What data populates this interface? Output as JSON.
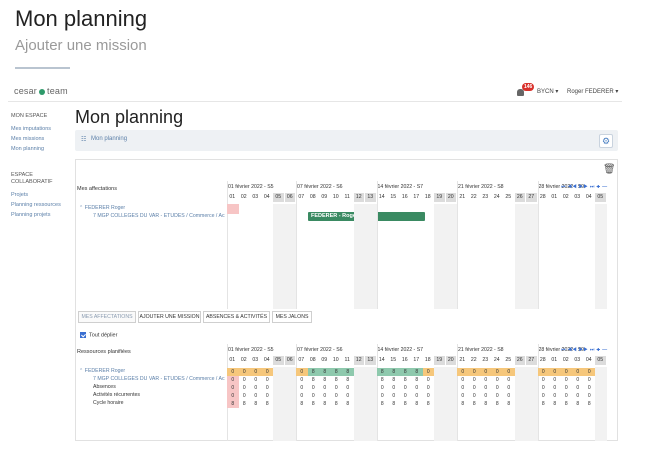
{
  "hero": {
    "title": "Mon planning",
    "subtitle": "Ajouter une mission"
  },
  "topbar": {
    "logo_left": "cesar",
    "logo_right": "team",
    "notif_count": "146",
    "company": "BYCN ▾",
    "user": "Roger FEDERER ▾"
  },
  "sidebar": {
    "section1": "MON ESPACE",
    "links1": [
      "Mes imputations",
      "Mes missions",
      "Mon planning"
    ],
    "section2a": "ESPACE",
    "section2b": "COLLABORATIF",
    "links2": [
      "Projets",
      "Planning ressources",
      "Planning projets"
    ]
  },
  "main": {
    "title": "Mon planning",
    "crumb": "Mon planning"
  },
  "planning": {
    "assign_header": "Mes affectations",
    "resources_header": "Ressources planifiées",
    "weeks": [
      "01 février 2022 - S5",
      "07 février 2022 - S6",
      "14 février 2022 - S7",
      "21 février 2022 - S8",
      "28 février 2022 - S9"
    ],
    "days": [
      "01",
      "02",
      "03",
      "04",
      "05",
      "06",
      "07",
      "08",
      "09",
      "10",
      "11",
      "12",
      "13",
      "14",
      "15",
      "16",
      "17",
      "18",
      "19",
      "20",
      "21",
      "22",
      "23",
      "24",
      "25",
      "26",
      "27",
      "28",
      "01",
      "02",
      "03",
      "04",
      "05"
    ],
    "weekend_idx": [
      4,
      5,
      11,
      12,
      18,
      19,
      25,
      26,
      32
    ],
    "nav": "⏮ ◀◀ ▶▶ ⏭ ✚ ━",
    "assign_parent": "⌃ FEDERER Roger",
    "assign_child": "7 MGP COLLEGES DU VAR - ETUDES / Commerce / Ac",
    "assignment_bar": "FEDERER - Roger",
    "toggle_all": "Tout déplier",
    "res_parent": "⌃ FEDERER Roger",
    "res_child": "7 MGP COLLEGES DU VAR - ETUDES / Commerce / Ac",
    "res_rows": [
      "Absences",
      "Activités récurrentes",
      "Cycle horaire"
    ]
  },
  "tabs": [
    "Mes affectations",
    "Ajouter une mission",
    "Absences & activités",
    "Mes jalons"
  ],
  "colors": {
    "accent": "#3a6fd1",
    "bar": "#3a8a62",
    "orange": "#f6c77b",
    "green": "#8ec9ad",
    "red": "#f7c5c5"
  },
  "row_values": {
    "summary": [
      "0",
      "0",
      "0",
      "0",
      "",
      "",
      "0",
      "8",
      "8",
      "8",
      "8",
      "",
      "",
      "8",
      "8",
      "8",
      "8",
      "0",
      "",
      "",
      "0",
      "0",
      "0",
      "0",
      "0",
      "",
      "",
      "0",
      "0",
      "0",
      "0",
      "0",
      ""
    ],
    "summary_color": [
      "o",
      "o",
      "o",
      "o",
      "",
      "",
      "o",
      "g",
      "g",
      "g",
      "g",
      "",
      "",
      "g",
      "g",
      "g",
      "g",
      "o",
      "",
      "",
      "o",
      "o",
      "o",
      "o",
      "o",
      "",
      "",
      "o",
      "o",
      "o",
      "o",
      "o",
      ""
    ],
    "child": [
      "0",
      "0",
      "0",
      "0",
      "",
      "",
      "0",
      "8",
      "8",
      "8",
      "8",
      "",
      "",
      "8",
      "8",
      "8",
      "8",
      "0",
      "",
      "",
      "0",
      "0",
      "0",
      "0",
      "0",
      "",
      "",
      "0",
      "0",
      "0",
      "0",
      "0",
      ""
    ],
    "absences": [
      "0",
      "0",
      "0",
      "0",
      "",
      "",
      "0",
      "0",
      "0",
      "0",
      "0",
      "",
      "",
      "0",
      "0",
      "0",
      "0",
      "0",
      "",
      "",
      "0",
      "0",
      "0",
      "0",
      "0",
      "",
      "",
      "0",
      "0",
      "0",
      "0",
      "0",
      ""
    ],
    "recurrent": [
      "0",
      "0",
      "0",
      "0",
      "",
      "",
      "0",
      "0",
      "0",
      "0",
      "0",
      "",
      "",
      "0",
      "0",
      "0",
      "0",
      "0",
      "",
      "",
      "0",
      "0",
      "0",
      "0",
      "0",
      "",
      "",
      "0",
      "0",
      "0",
      "0",
      "0",
      ""
    ],
    "cycle": [
      "8",
      "8",
      "8",
      "8",
      "",
      "",
      "8",
      "8",
      "8",
      "8",
      "8",
      "",
      "",
      "8",
      "8",
      "8",
      "8",
      "8",
      "",
      "",
      "8",
      "8",
      "8",
      "8",
      "8",
      "",
      "",
      "8",
      "8",
      "8",
      "8",
      "8",
      ""
    ]
  }
}
